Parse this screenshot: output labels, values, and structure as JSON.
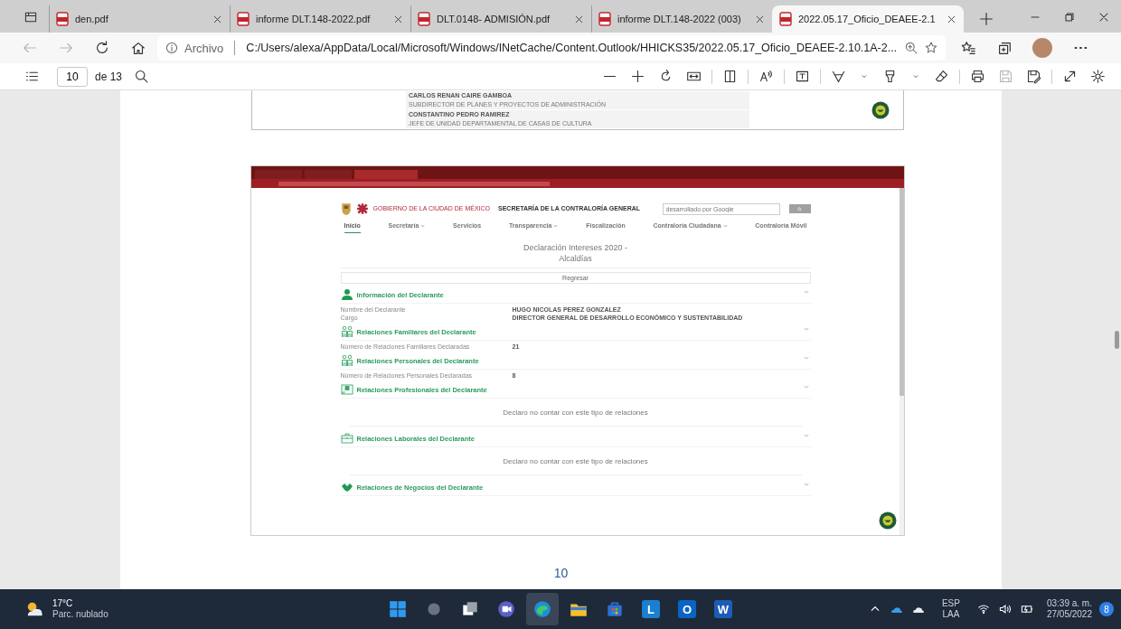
{
  "browser": {
    "tabs": [
      {
        "title": "den.pdf",
        "selected": false
      },
      {
        "title": "informe DLT.148-2022.pdf",
        "selected": false
      },
      {
        "title": "DLT.0148- ADMISIÓN.pdf",
        "selected": false
      },
      {
        "title": "informe DLT.148-2022 (003)",
        "selected": false
      },
      {
        "title": "2022.05.17_Oficio_DEAEE-2.1",
        "selected": true
      }
    ],
    "back_disabled": true,
    "forward_disabled": true,
    "address": {
      "security_label": "Archivo",
      "url": "C:/Users/alexa/AppData/Local/Microsoft/Windows/INetCache/Content.Outlook/HHICKS35/2022.05.17_Oficio_DEAEE-2.10.1A-2..."
    }
  },
  "pdf_toolbar": {
    "page": "10",
    "page_count": "de 13",
    "save_disabled": true
  },
  "document": {
    "page_top": {
      "entries": [
        {
          "name": "CARLOS RENAN CAIRE GAMBOA",
          "position": "SUBDIRECTOR DE PLANES Y PROYECTOS DE ADMINISTRACIÓN"
        },
        {
          "name": "CONSTANTINO PEDRO RAMIREZ",
          "position": "JEFE DE UNIDAD DEPARTAMENTAL DE CASAS DE CULTURA"
        }
      ]
    },
    "embedded_page": {
      "logo": {
        "government": "GOBIERNO DE LA CIUDAD DE MÉXICO",
        "secretariat": "SECRETARÍA DE LA CONTRALORÍA GENERAL"
      },
      "search": {
        "placeholder": "desarrollado por Google"
      },
      "nav": [
        {
          "label": "Inicio",
          "selected": true,
          "dropdown": false
        },
        {
          "label": "Secretaría",
          "selected": false,
          "dropdown": true
        },
        {
          "label": "Servicios",
          "selected": false,
          "dropdown": false
        },
        {
          "label": "Transparencia",
          "selected": false,
          "dropdown": true
        },
        {
          "label": "Fiscalización",
          "selected": false,
          "dropdown": false
        },
        {
          "label": "Contraloría Ciudadana",
          "selected": false,
          "dropdown": true
        },
        {
          "label": "Contraloría Móvil",
          "selected": false,
          "dropdown": false
        }
      ],
      "title": "Declaración Intereses 2020 -",
      "subtitle": "Alcaldías",
      "back_button": "Regresar",
      "sections": [
        {
          "kind": "person",
          "title": "Información del Declarante",
          "fields": [
            {
              "label": "Nombre del Declarante",
              "value": "HUGO NICOLAS PEREZ GONZALEZ"
            },
            {
              "label": "Cargo",
              "value": "DIRECTOR GENERAL DE DESARROLLO ECONÓMICO Y SUSTENTABILIDAD"
            }
          ]
        },
        {
          "kind": "family",
          "title": "Relaciones Familiares del Declarante",
          "fields": [
            {
              "label": "Número de Relaciones Familiares Declaradas",
              "value": "21"
            }
          ]
        },
        {
          "kind": "family",
          "title": "Relaciones Personales del Declarante",
          "fields": [
            {
              "label": "Número de Relaciones Personales Declaradas",
              "value": "8"
            }
          ]
        },
        {
          "kind": "id-card",
          "title": "Relaciones Profesionales del Declarante",
          "message": "Declaro no contar con este tipo de relaciones"
        },
        {
          "kind": "briefcase",
          "title": "Relaciones Laborales del Declarante",
          "message": "Declaro no contar con este tipo de relaciones"
        },
        {
          "kind": "handshake",
          "title": "Relaciones de Negocios del Declarante"
        }
      ]
    },
    "page_number": "10"
  },
  "taskbar": {
    "weather": {
      "temperature": "17°C",
      "condition": "Parc. nublado"
    },
    "apps": [
      {
        "kind": "windows",
        "selected": false
      },
      {
        "kind": "search",
        "selected": false
      },
      {
        "kind": "task-view",
        "selected": false
      },
      {
        "kind": "chat",
        "selected": false
      },
      {
        "kind": "edge",
        "selected": true
      },
      {
        "kind": "folder",
        "selected": false
      },
      {
        "kind": "store",
        "selected": false
      },
      {
        "kind": "letter",
        "label": "L",
        "selected": false
      },
      {
        "kind": "outlook",
        "label": "O",
        "selected": false
      },
      {
        "kind": "word",
        "label": "W",
        "selected": false
      }
    ],
    "language": "ESP",
    "layout": "LAA",
    "time": "03:39 a. m.",
    "date": "27/05/2022",
    "notification_count": "8"
  }
}
